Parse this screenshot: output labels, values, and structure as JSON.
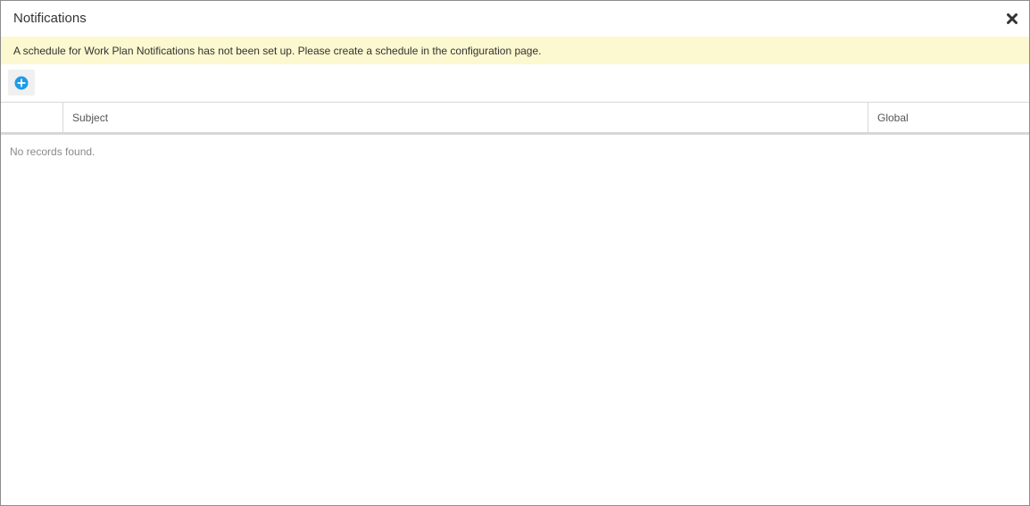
{
  "dialog": {
    "title": "Notifications",
    "close_icon": "close-icon"
  },
  "banner": {
    "message": "A schedule for Work Plan Notifications has not been set up. Please create a schedule in the configuration page.",
    "background": "#fcf8cf"
  },
  "toolbar": {
    "add_icon": "plus-circle-icon",
    "accent": "#1e9be8"
  },
  "grid": {
    "columns": [
      "",
      "Subject",
      "Global"
    ],
    "empty_message": "No records found."
  }
}
